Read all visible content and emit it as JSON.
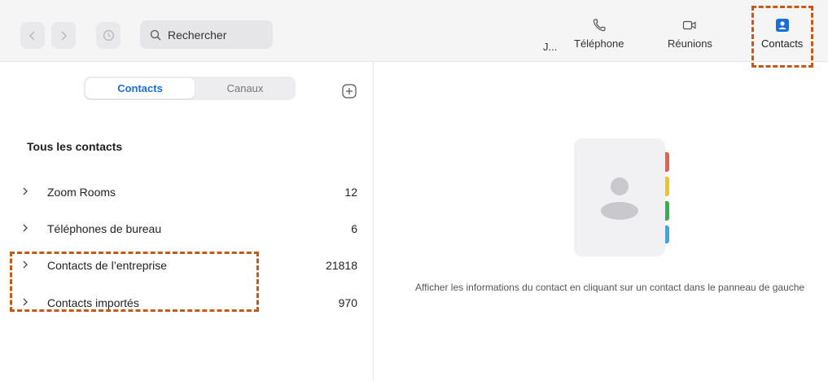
{
  "toolbar": {
    "search_placeholder": "Rechercher"
  },
  "tabs": [
    {
      "label": "J...",
      "icon": "truncated"
    },
    {
      "label": "Téléphone",
      "icon": "phone-icon"
    },
    {
      "label": "Réunions",
      "icon": "video-camera-icon"
    },
    {
      "label": "Contacts",
      "icon": "contact-card-icon"
    }
  ],
  "segmented": {
    "active": "Contacts",
    "inactive": "Canaux"
  },
  "section": {
    "title": "Tous les contacts"
  },
  "groups": [
    {
      "name": "Zoom Rooms",
      "count": "12"
    },
    {
      "name": "Téléphones de bureau",
      "count": "6"
    },
    {
      "name": "Contacts de l’entreprise",
      "count": "21818"
    },
    {
      "name": "Contacts importés",
      "count": "970"
    }
  ],
  "empty_state": {
    "text": "Afficher les informations du contact en cliquant sur un contact dans le panneau de gauche"
  },
  "colors": {
    "accent": "#1a6fd6",
    "highlight": "#c45a1a",
    "tab_red": "#e8604a",
    "tab_yellow": "#f3c416",
    "tab_green": "#2fb34a",
    "tab_blue": "#3aa7e8"
  }
}
